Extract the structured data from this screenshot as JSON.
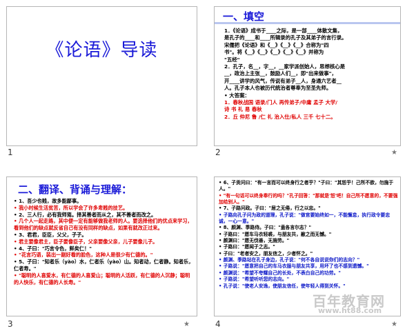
{
  "slides": [
    {
      "number": "1",
      "title": "《论语》导读"
    },
    {
      "number": "2",
      "heading": "一、填空",
      "lines_black": [
        "1．《论语》成书于____之际，是一部____体散文集，",
        "是孔子的____和____所辑录的孔子及其弟子的言行录。",
        "宋儒把《论语》和《__》《__》《__》合称为\"四",
        "书\"。将《__》《__》《__》《__》《__》并称为",
        "\"五经\"",
        "2．孔子，名__，字__，__家学派创始人，思想核心是",
        "__，政治上主张__，鼓励人们__，即\"出来做事\"，",
        "开____讲学的风气，传说有弟子__人，身通六艺者__",
        "人。孔子本人也被历代统治者尊奉为至圣先师。",
        "• 大答案："
      ],
      "lines_red": [
        "1．春秋战国 语录/门人 再传弟子/中庸 孟子 大学/",
        "诗 书 礼 易 春秋",
        "2．丘 仲尼 鲁 /仁 礼 治入仕/私人 三千 七十二。"
      ]
    },
    {
      "number": "3",
      "heading": "二、翻译、背诵与理解：",
      "items": [
        {
          "c": "black",
          "t": "• 1、吾少也贱，故多能鄙事。"
        },
        {
          "c": "red",
          "t": "• 我小时候生活贫苦，所以学会了许多卑贱的技艺。"
        },
        {
          "c": "black",
          "t": "• 2、三人行，必有我师焉。择其善者而从之，其不善者而改之。"
        },
        {
          "c": "red",
          "t": "• 几个人一起走路，其中便一定有能够做我老师的人。要选择他们的优点来学习，看到他们的缺点就反省自己有没有同样的缺点，如果有就改正过来。"
        },
        {
          "c": "black",
          "t": "• 3、君君，臣臣，父父，子子。"
        },
        {
          "c": "red",
          "t": "• 君主要像君主，臣子要像臣子，父亲要像父亲，儿子要像儿子。"
        },
        {
          "c": "black",
          "t": "• 4、子曰：\"巧言令色，鲜矣仁！\""
        },
        {
          "c": "red",
          "t": "• \"花言巧语，装出一副好看的脸色，这种人是很少有仁德的。\""
        },
        {
          "c": "black",
          "t": "• 5、子曰：\"知者乐（yào）水，仁者乐（yào）山。知者动，仁者静。知者乐，仁者寿。\""
        },
        {
          "c": "red",
          "t": "• \"聪明的人喜爱水，有仁德的人喜爱山；聪明的人活跃，有仁德的人沉静；聪明的人快乐，有仁德的人长寿。\""
        }
      ]
    },
    {
      "number": "4",
      "items": [
        {
          "c": "black",
          "t": "• 6、子贡问曰：\"有一言而可以终身行之者乎？\"子曰：\"其恕乎！己所不欲，勿施于人。\""
        },
        {
          "c": "red",
          "t": "• \"有一句话可以终身奉行的吗？\"孔子回答：\"那就是'恕'吧！自己所不愿意的，不要强加给别人。\""
        },
        {
          "c": "black",
          "t": "• 7、子路问政。子曰：\"居之无倦，行之以忠。\""
        },
        {
          "c": "blue",
          "t": "• 子路向孔子问为政的道理，孔子说：\"做官要始终如一，不能懈怠，执行政令要忠诚，一心一意。\""
        },
        {
          "c": "black",
          "t": "• 8、颜渊、季路侍。子曰：\"盍各言尔志？\""
        },
        {
          "c": "black",
          "t": "• 子路曰：\"愿车马衣轻裘，与朋友共，敝之而无憾。\""
        },
        {
          "c": "black",
          "t": "• 颜渊曰：\"愿无伐善，无施劳。\""
        },
        {
          "c": "black",
          "t": "• 子路曰：\"愿闻子之志。\""
        },
        {
          "c": "black",
          "t": "• 子曰：\"老者安之，朋友信之，少者怀之。\""
        },
        {
          "c": "blue",
          "t": "• 颜渊、季路站在孔子身边，孔子说：\"何不各自说说你们的志向？\""
        },
        {
          "c": "blue",
          "t": "• 子路说：\"愿意把自己的车马衣服与朋友共享，用坏了也不感到遗憾。\""
        },
        {
          "c": "blue",
          "t": "• 颜渊说：\"希望不夸耀自己的长处，不表白自己的功劳。\""
        },
        {
          "c": "blue",
          "t": "• 子路说：\"希望听听您的志向。\""
        },
        {
          "c": "blue",
          "t": "• 孔子说：\"使老人安逸，使朋友信任，使年轻人得到关怀。\""
        }
      ]
    }
  ],
  "watermark": {
    "line1": "百年教育网",
    "line2": "www.ht88.com"
  }
}
